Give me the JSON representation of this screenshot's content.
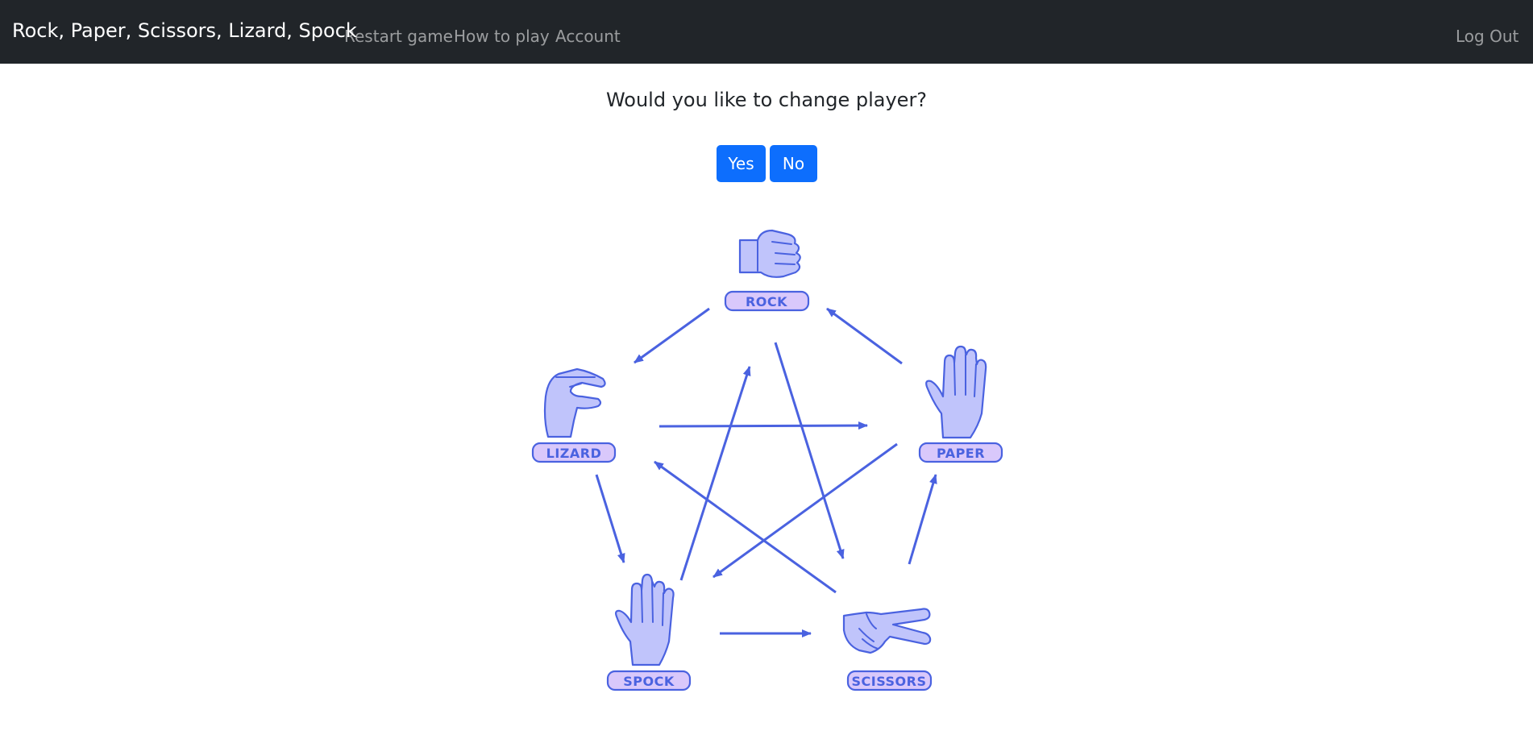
{
  "navbar": {
    "brand": "Rock, Paper, Scissors, Lizard, Spock",
    "links": [
      {
        "label": "Restart game"
      },
      {
        "label": "How to play"
      },
      {
        "label": "Account"
      }
    ],
    "logout": "Log Out"
  },
  "prompt": {
    "question": "Would you like to change player?",
    "yes": "Yes",
    "no": "No"
  },
  "choices": {
    "rock": {
      "label": "ROCK",
      "icon": "rock-fist-icon"
    },
    "paper": {
      "label": "PAPER",
      "icon": "paper-hand-icon"
    },
    "scissors": {
      "label": "SCISSORS",
      "icon": "scissors-hand-icon"
    },
    "lizard": {
      "label": "LIZARD",
      "icon": "lizard-hand-icon"
    },
    "spock": {
      "label": "SPOCK",
      "icon": "spock-hand-icon"
    }
  },
  "colors": {
    "navbar_bg": "#212529",
    "primary_button": "#0d6efd",
    "diagram_stroke": "#4a62e0",
    "hand_fill": "#c0c4fb",
    "badge_fill": "#d9c8fb"
  }
}
